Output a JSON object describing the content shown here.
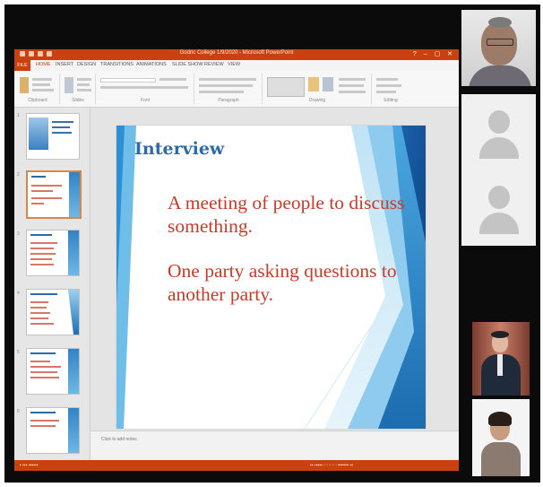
{
  "window": {
    "title": "Godric College 1/9/2020 - Microsoft PowerPoint",
    "controls": "? – ▢ ✕"
  },
  "ribbon": {
    "tabs": [
      "FILE",
      "HOME",
      "INSERT",
      "DESIGN",
      "TRANSITIONS",
      "ANIMATIONS",
      "SLIDE SHOW",
      "REVIEW",
      "VIEW"
    ],
    "groups": [
      "Clipboard",
      "Slides",
      "Font",
      "Paragraph",
      "Drawing",
      "Editing"
    ]
  },
  "slide_panel": {
    "slide_numbers": [
      "1",
      "2",
      "3",
      "4",
      "5",
      "6"
    ],
    "selected_index": 2
  },
  "slide": {
    "title": "Interview",
    "bullets": [
      "A meeting of people to discuss something.",
      "One party asking questions to another party."
    ]
  },
  "notes": {
    "placeholder": "Click to add notes"
  },
  "colors": {
    "accent": "#c8410f",
    "slide_title": "#2e6aa8",
    "slide_body": "#c83b28",
    "frame": "#0b0b0b"
  },
  "video_tiles": [
    {
      "kind": "camera",
      "person": "man-with-glasses"
    },
    {
      "kind": "avatar-placeholder"
    },
    {
      "kind": "avatar-placeholder"
    },
    {
      "kind": "camera",
      "person": "person-in-suit"
    },
    {
      "kind": "camera",
      "person": "woman"
    }
  ]
}
